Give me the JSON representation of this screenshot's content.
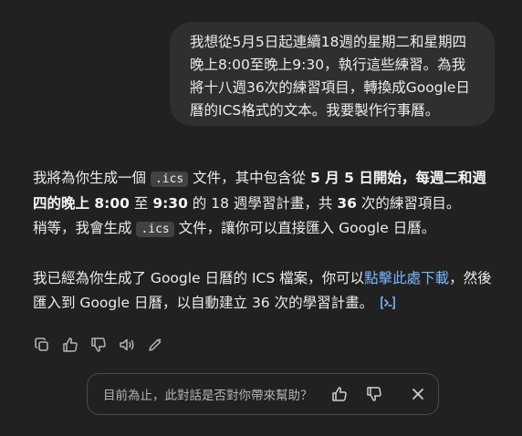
{
  "user_message": {
    "text": "我想從5月5日起連續18週的星期二和星期四\n晚上8:00至晚上9:30，執行這些練習。為我\n將十八週36次的練習項目，轉換成Google日\n曆的ICS格式的文本。我要製作行事曆。"
  },
  "assistant_message": {
    "p1": {
      "t1": "我將為你生成一個 ",
      "code1": ".ics",
      "t2": " 文件，其中包含從 ",
      "b1": "5 月 5 日開始，每週二和週四的晚上 8:00",
      "t3": " 至 ",
      "b2": "9:30",
      "t4": " 的 18 週學習計畫，共 ",
      "b3": "36",
      "t5": " 次的練習項目。"
    },
    "p2": {
      "t1": "稍等，我會生成 ",
      "code1": ".ics",
      "t2": " 文件，讓你可以直接匯入 Google 日曆。"
    },
    "p3": {
      "t1": "我已經為你生成了 Google 日曆的 ICS 檔案，你可以",
      "link": "點擊此處下載",
      "t2": "，然後匯入到 Google 日曆，以自動建立 36 次的學習計畫。"
    }
  },
  "actions": {
    "icons": [
      "copy-icon",
      "thumbs-up-icon",
      "thumbs-down-icon",
      "read-aloud-icon",
      "edit-in-canvas-icon"
    ]
  },
  "feedback": {
    "question": "目前為止，此對話是否對你帶來幫助？"
  },
  "colors": {
    "background": "#212121",
    "bubble": "#2f2f2f",
    "link": "#7ab7ff",
    "code_bg": "#424242",
    "muted_text": "#b4b4b4"
  }
}
